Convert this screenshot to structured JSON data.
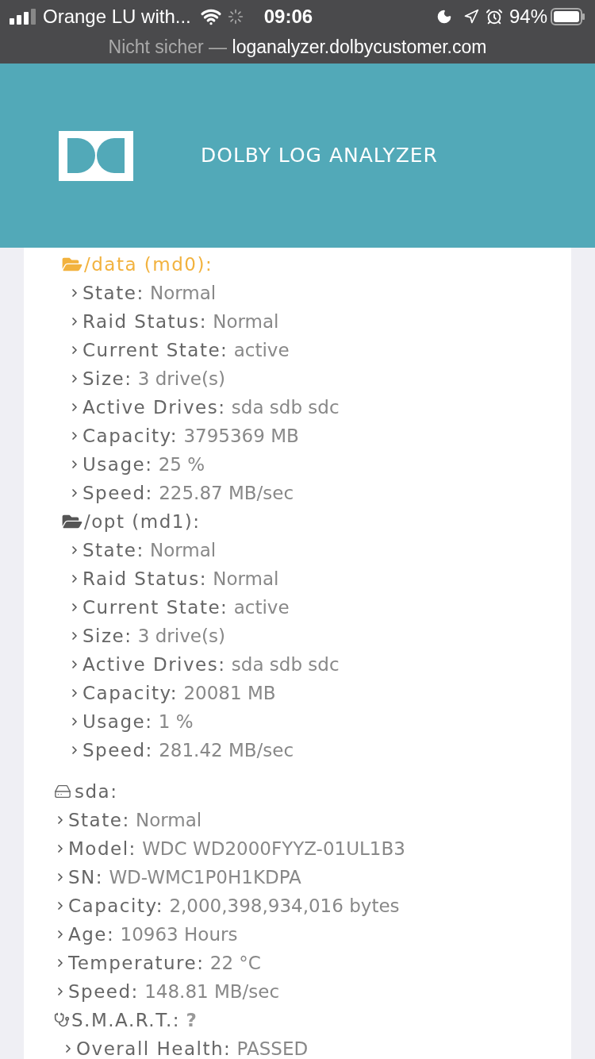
{
  "status_bar": {
    "carrier": "Orange LU with...",
    "time": "09:06",
    "battery": "94%"
  },
  "url_bar": {
    "security": "Nicht sicher —",
    "host": "loganalyzer.dolbycustomer.com"
  },
  "header": {
    "title": "DOLBY LOG ANALYZER"
  },
  "volumes": [
    {
      "title": "/data (md0):",
      "highlighted": true,
      "rows": [
        {
          "label": "State:",
          "value": "Normal"
        },
        {
          "label": "Raid Status:",
          "value": "Normal"
        },
        {
          "label": "Current State:",
          "value": "active"
        },
        {
          "label": "Size:",
          "value": "3 drive(s)"
        },
        {
          "label": "Active Drives:",
          "value": "sda sdb sdc"
        },
        {
          "label": "Capacity:",
          "value": "3795369 MB"
        },
        {
          "label": "Usage:",
          "value": "25 %"
        },
        {
          "label": "Speed:",
          "value": "225.87 MB/sec"
        }
      ]
    },
    {
      "title": "/opt (md1):",
      "highlighted": false,
      "rows": [
        {
          "label": "State:",
          "value": "Normal"
        },
        {
          "label": "Raid Status:",
          "value": "Normal"
        },
        {
          "label": "Current State:",
          "value": "active"
        },
        {
          "label": "Size:",
          "value": "3 drive(s)"
        },
        {
          "label": "Active Drives:",
          "value": "sda sdb sdc"
        },
        {
          "label": "Capacity:",
          "value": "20081 MB"
        },
        {
          "label": "Usage:",
          "value": "1 %"
        },
        {
          "label": "Speed:",
          "value": "281.42 MB/sec"
        }
      ]
    }
  ],
  "disks": [
    {
      "title": "sda:",
      "rows": [
        {
          "label": "State:",
          "value": "Normal"
        },
        {
          "label": "Model:",
          "value": "WDC WD2000FYYZ-01UL1B3"
        },
        {
          "label": "SN:",
          "value": "WD-WMC1P0H1KDPA"
        },
        {
          "label": "Capacity:",
          "value": "2,000,398,934,016 bytes"
        },
        {
          "label": "Age:",
          "value": "10963 Hours"
        },
        {
          "label": "Temperature:",
          "value": "22 °C"
        },
        {
          "label": "Speed:",
          "value": "148.81 MB/sec"
        }
      ],
      "smart": {
        "title": "S.M.A.R.T.:",
        "value": "?",
        "rows": [
          {
            "label": "Overall Health:",
            "value": "PASSED"
          }
        ]
      }
    }
  ]
}
